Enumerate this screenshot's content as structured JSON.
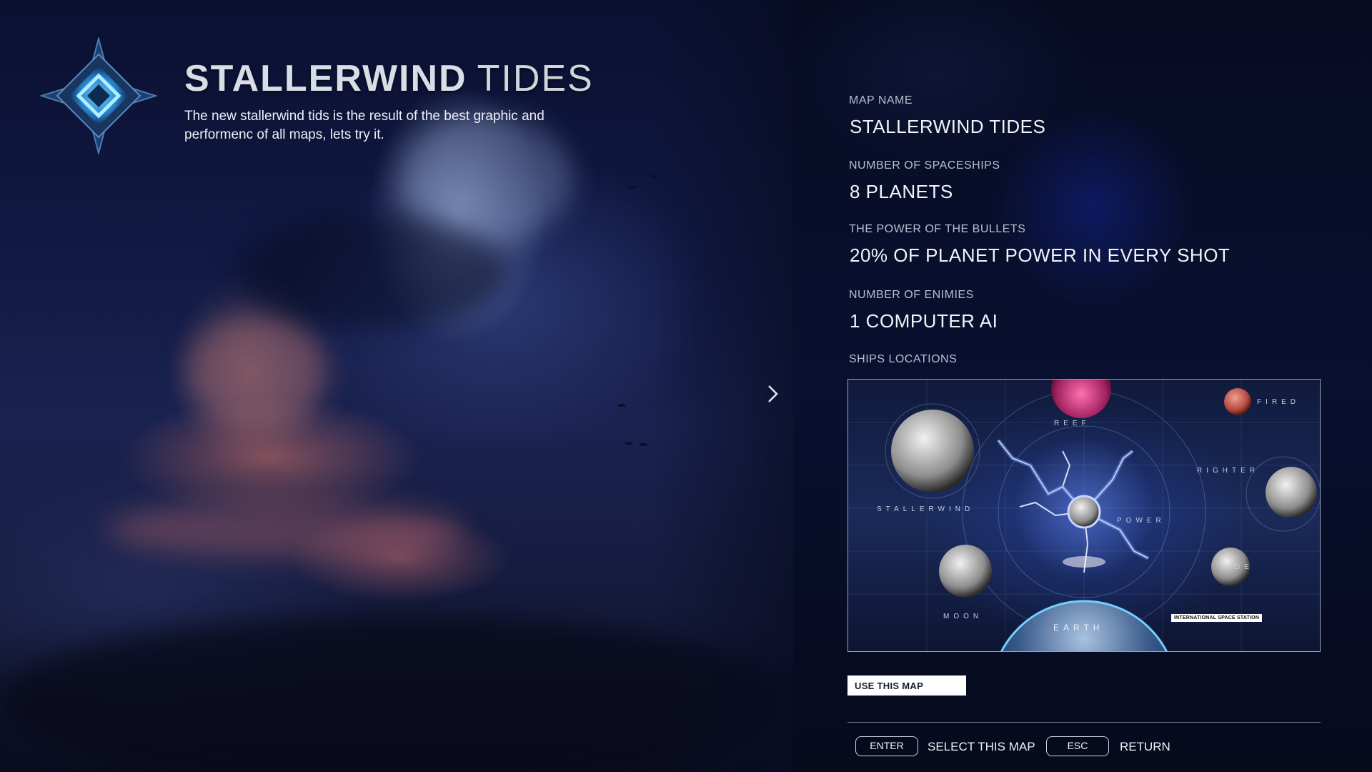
{
  "title": {
    "bold": "STALLERWIND",
    "light": "TIDES"
  },
  "description": "The new stallerwind tids is the result of the best graphic and performenc of all maps, lets try it.",
  "fields": [
    {
      "label": "MAP NAME",
      "value": "STALLERWIND TIDES"
    },
    {
      "label": "NUMBER OF SPACESHIPS",
      "value": "8 PLANETS"
    },
    {
      "label": "THE POWER OF THE BULLETS",
      "value": "20% OF PLANET POWER IN EVERY SHOT"
    },
    {
      "label": "NUMBER OF ENIMIES",
      "value": "1 COMPUTER AI"
    }
  ],
  "map": {
    "label": "SHIPS LOCATIONS",
    "places": {
      "reef": "REEF",
      "fired": "FIRED",
      "righter": "RIGHTER",
      "stallerwind": "STALLERWIND",
      "power": "POWER",
      "tide": "TIDE",
      "moon": "MOON",
      "earth": "EARTH"
    },
    "iss": "INTERNATIONAL SPACE STATION"
  },
  "actions": {
    "use_map": "USE THIS MAP",
    "enter_key": "ENTER",
    "enter_label": "SELECT THIS MAP",
    "esc_key": "ESC",
    "esc_label": "RETURN"
  },
  "icons": {
    "emblem": "diamond-emblem-icon",
    "next": "chevron-right-icon"
  },
  "colors": {
    "accent": "#3fb0ff",
    "panel": "#070c22",
    "button": "#ffffff"
  }
}
